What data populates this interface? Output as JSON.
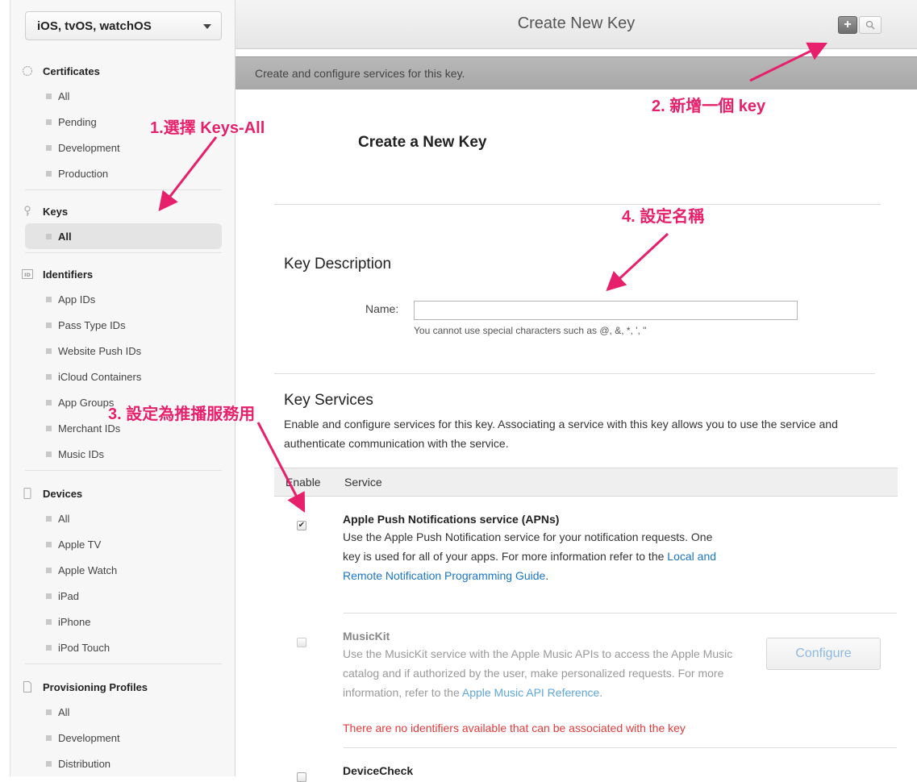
{
  "sidebar": {
    "platform": "iOS, tvOS, watchOS",
    "sections": [
      {
        "title": "Certificates",
        "icon": "certificate-icon",
        "items": [
          "All",
          "Pending",
          "Development",
          "Production"
        ]
      },
      {
        "title": "Keys",
        "icon": "key-icon",
        "items": [
          "All"
        ]
      },
      {
        "title": "Identifiers",
        "icon": "id-icon",
        "items": [
          "App IDs",
          "Pass Type IDs",
          "Website Push IDs",
          "iCloud Containers",
          "App Groups",
          "Merchant IDs",
          "Music IDs"
        ]
      },
      {
        "title": "Devices",
        "icon": "device-icon",
        "items": [
          "All",
          "Apple TV",
          "Apple Watch",
          "iPad",
          "iPhone",
          "iPod Touch"
        ]
      },
      {
        "title": "Provisioning Profiles",
        "icon": "document-icon",
        "items": [
          "All",
          "Development",
          "Distribution"
        ]
      }
    ]
  },
  "topbar": {
    "title": "Create New Key"
  },
  "subbar": {
    "text": "Create and configure services for this key."
  },
  "main": {
    "heading": "Create a New Key",
    "key_description": {
      "title": "Key Description",
      "name_label": "Name:",
      "name_value": "",
      "name_hint": "You cannot use special characters such as @, &, *, ', \""
    },
    "key_services": {
      "title": "Key Services",
      "description": "Enable and configure services for this key. Associating a service with this key allows you to use the service and authenticate communication with the service.",
      "col_enable": "Enable",
      "col_service": "Service",
      "services": [
        {
          "name": "Apple Push Notifications service (APNs)",
          "desc_before": "Use the Apple Push Notification service for your notification requests. One key is used for all of your apps. For more information refer to the ",
          "link": "Local and Remote Notification Programming Guide",
          "desc_after": ".",
          "checked": true
        },
        {
          "name": "MusicKit",
          "desc_before": "Use the MusicKit service with the Apple Music APIs to access the Apple Music catalog and if authorized by the user, make personalized requests. For more information, refer to the ",
          "link": "Apple Music API Reference",
          "desc_after": ".",
          "error": "There are no identifiers available that can be associated with the key",
          "configure_label": "Configure",
          "checked": false
        },
        {
          "name": "DeviceCheck",
          "checked": false
        }
      ]
    }
  },
  "annotations": {
    "step1": "1.選擇 Keys-All",
    "step2": "2. 新增一個 key",
    "step3": "3. 設定為推播服務用",
    "step4": "4. 設定名稱"
  },
  "colors": {
    "annotation": "#e6206b",
    "link": "#1a75c4",
    "error": "#e03b3b"
  }
}
